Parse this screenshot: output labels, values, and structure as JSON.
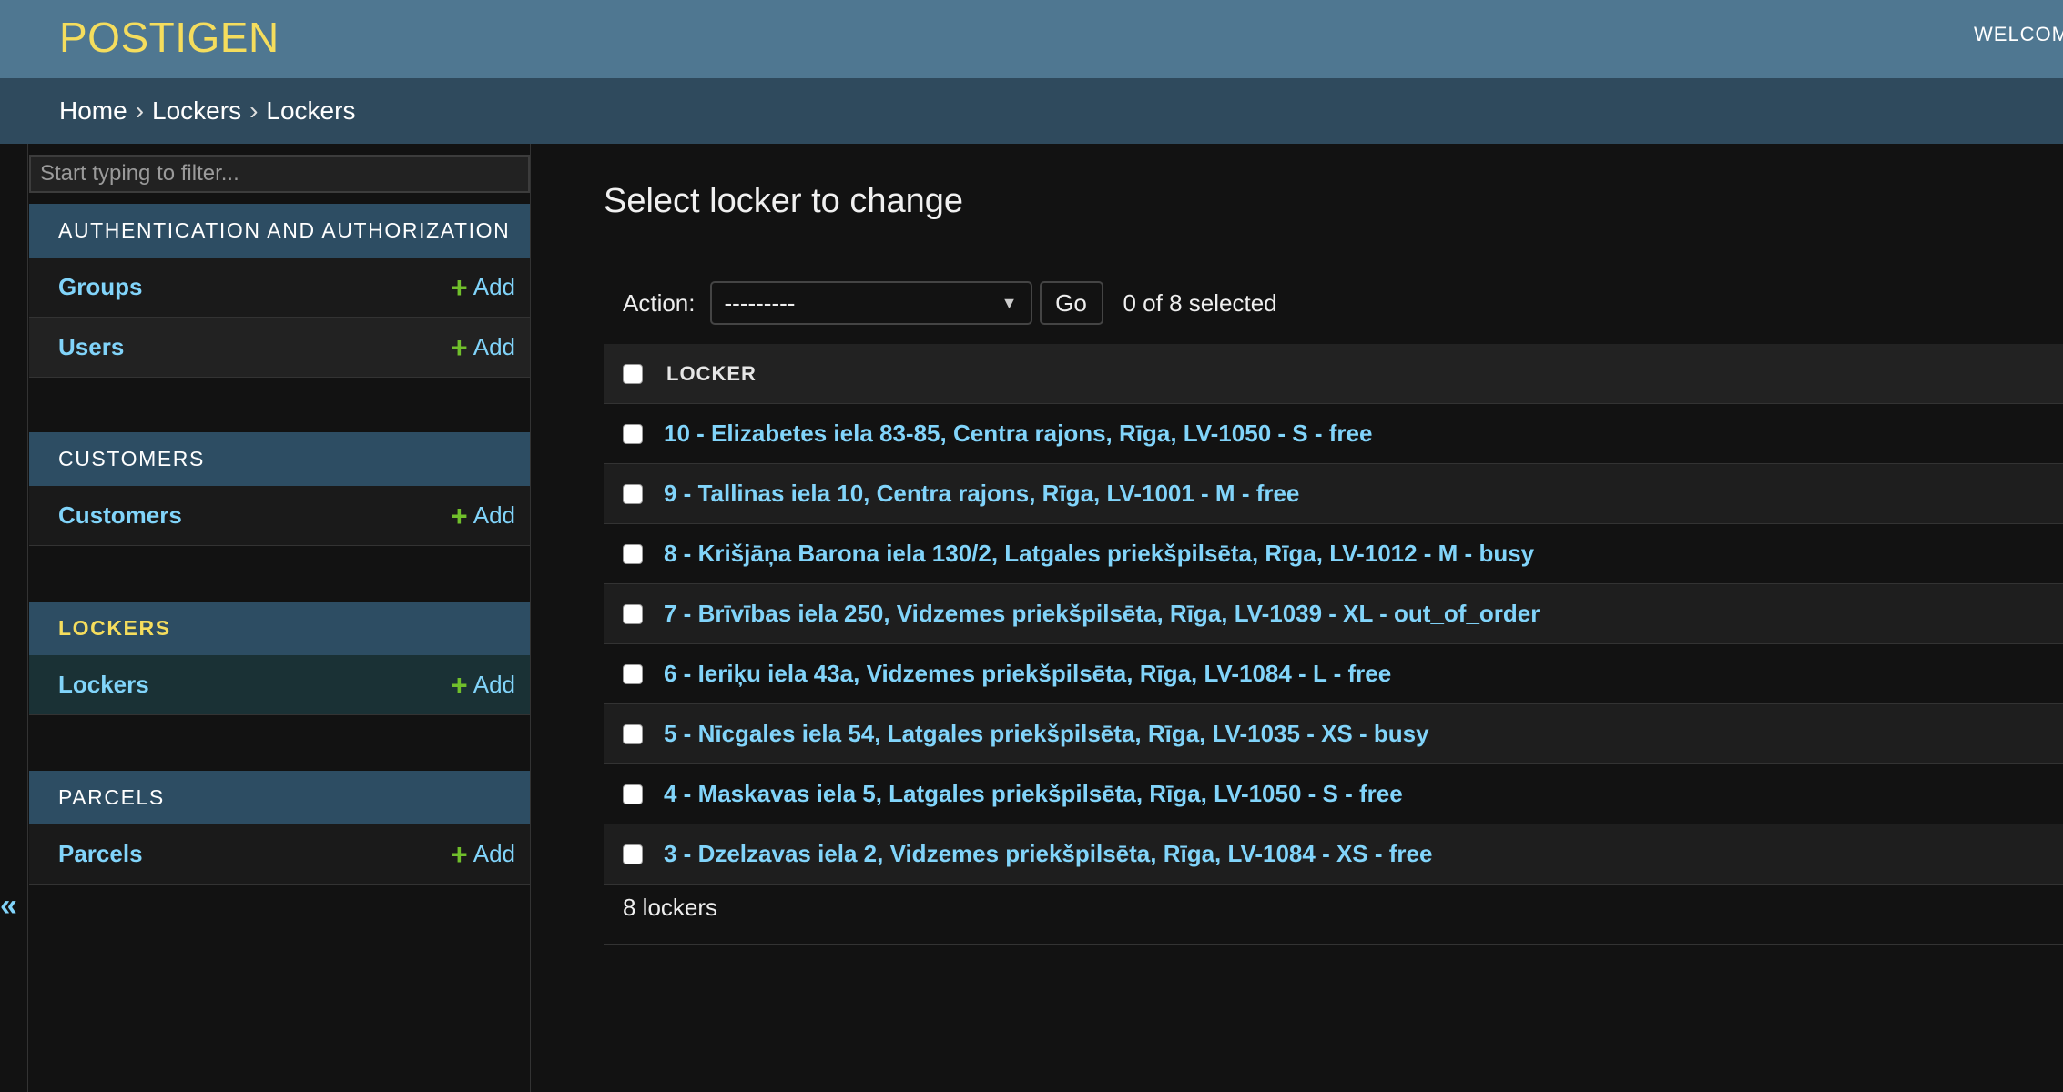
{
  "header": {
    "branding": "POSTIGEN",
    "user_tools": "WELCOM"
  },
  "breadcrumbs": {
    "items": [
      "Home",
      "Lockers",
      "Lockers"
    ],
    "separator": "›"
  },
  "sidebar": {
    "filter_placeholder": "Start typing to filter...",
    "collapse_label": "«",
    "modules": [
      {
        "caption": "AUTHENTICATION AND AUTHORIZATION",
        "models": [
          {
            "name": "Groups",
            "add_label": "Add"
          },
          {
            "name": "Users",
            "add_label": "Add"
          }
        ]
      },
      {
        "caption": "CUSTOMERS",
        "models": [
          {
            "name": "Customers",
            "add_label": "Add"
          }
        ]
      },
      {
        "caption": "LOCKERS",
        "current": true,
        "models": [
          {
            "name": "Lockers",
            "add_label": "Add",
            "current": true
          }
        ]
      },
      {
        "caption": "PARCELS",
        "models": [
          {
            "name": "Parcels",
            "add_label": "Add"
          }
        ]
      }
    ]
  },
  "content": {
    "title": "Select locker to change",
    "actions": {
      "label": "Action:",
      "selected_option": "---------",
      "go_label": "Go",
      "counter": "0 of 8 selected"
    },
    "table": {
      "column_header": "LOCKER",
      "rows": [
        "10 - Elizabetes iela 83-85, Centra rajons, Rīga, LV-1050 - S - free",
        "9 - Tallinas iela 10, Centra rajons, Rīga, LV-1001 - M - free",
        "8 - Krišjāņa Barona iela 130/2, Latgales priekšpilsēta, Rīga, LV-1012 - M - busy",
        "7 - Brīvības iela 250, Vidzemes priekšpilsēta, Rīga, LV-1039 - XL - out_of_order",
        "6 - Ieriķu iela 43a, Vidzemes priekšpilsēta, Rīga, LV-1084 - L - free",
        "5 - Nīcgales iela 54, Latgales priekšpilsēta, Rīga, LV-1035 - XS - busy",
        "4 - Maskavas iela 5, Latgales priekšpilsēta, Rīga, LV-1050 - S - free",
        "3 - Dzelzavas iela 2, Vidzemes priekšpilsēta, Rīga, LV-1084 - XS - free"
      ]
    },
    "paginator": "8 lockers"
  },
  "colors": {
    "header_bg": "#4f7791",
    "breadcrumb_bg": "#2f4a5d",
    "module_caption_bg": "#2d4d63",
    "link": "#81d4fa",
    "branding": "#f5dd5d",
    "add_icon": "#70bf2b",
    "body_bg": "#121212"
  }
}
